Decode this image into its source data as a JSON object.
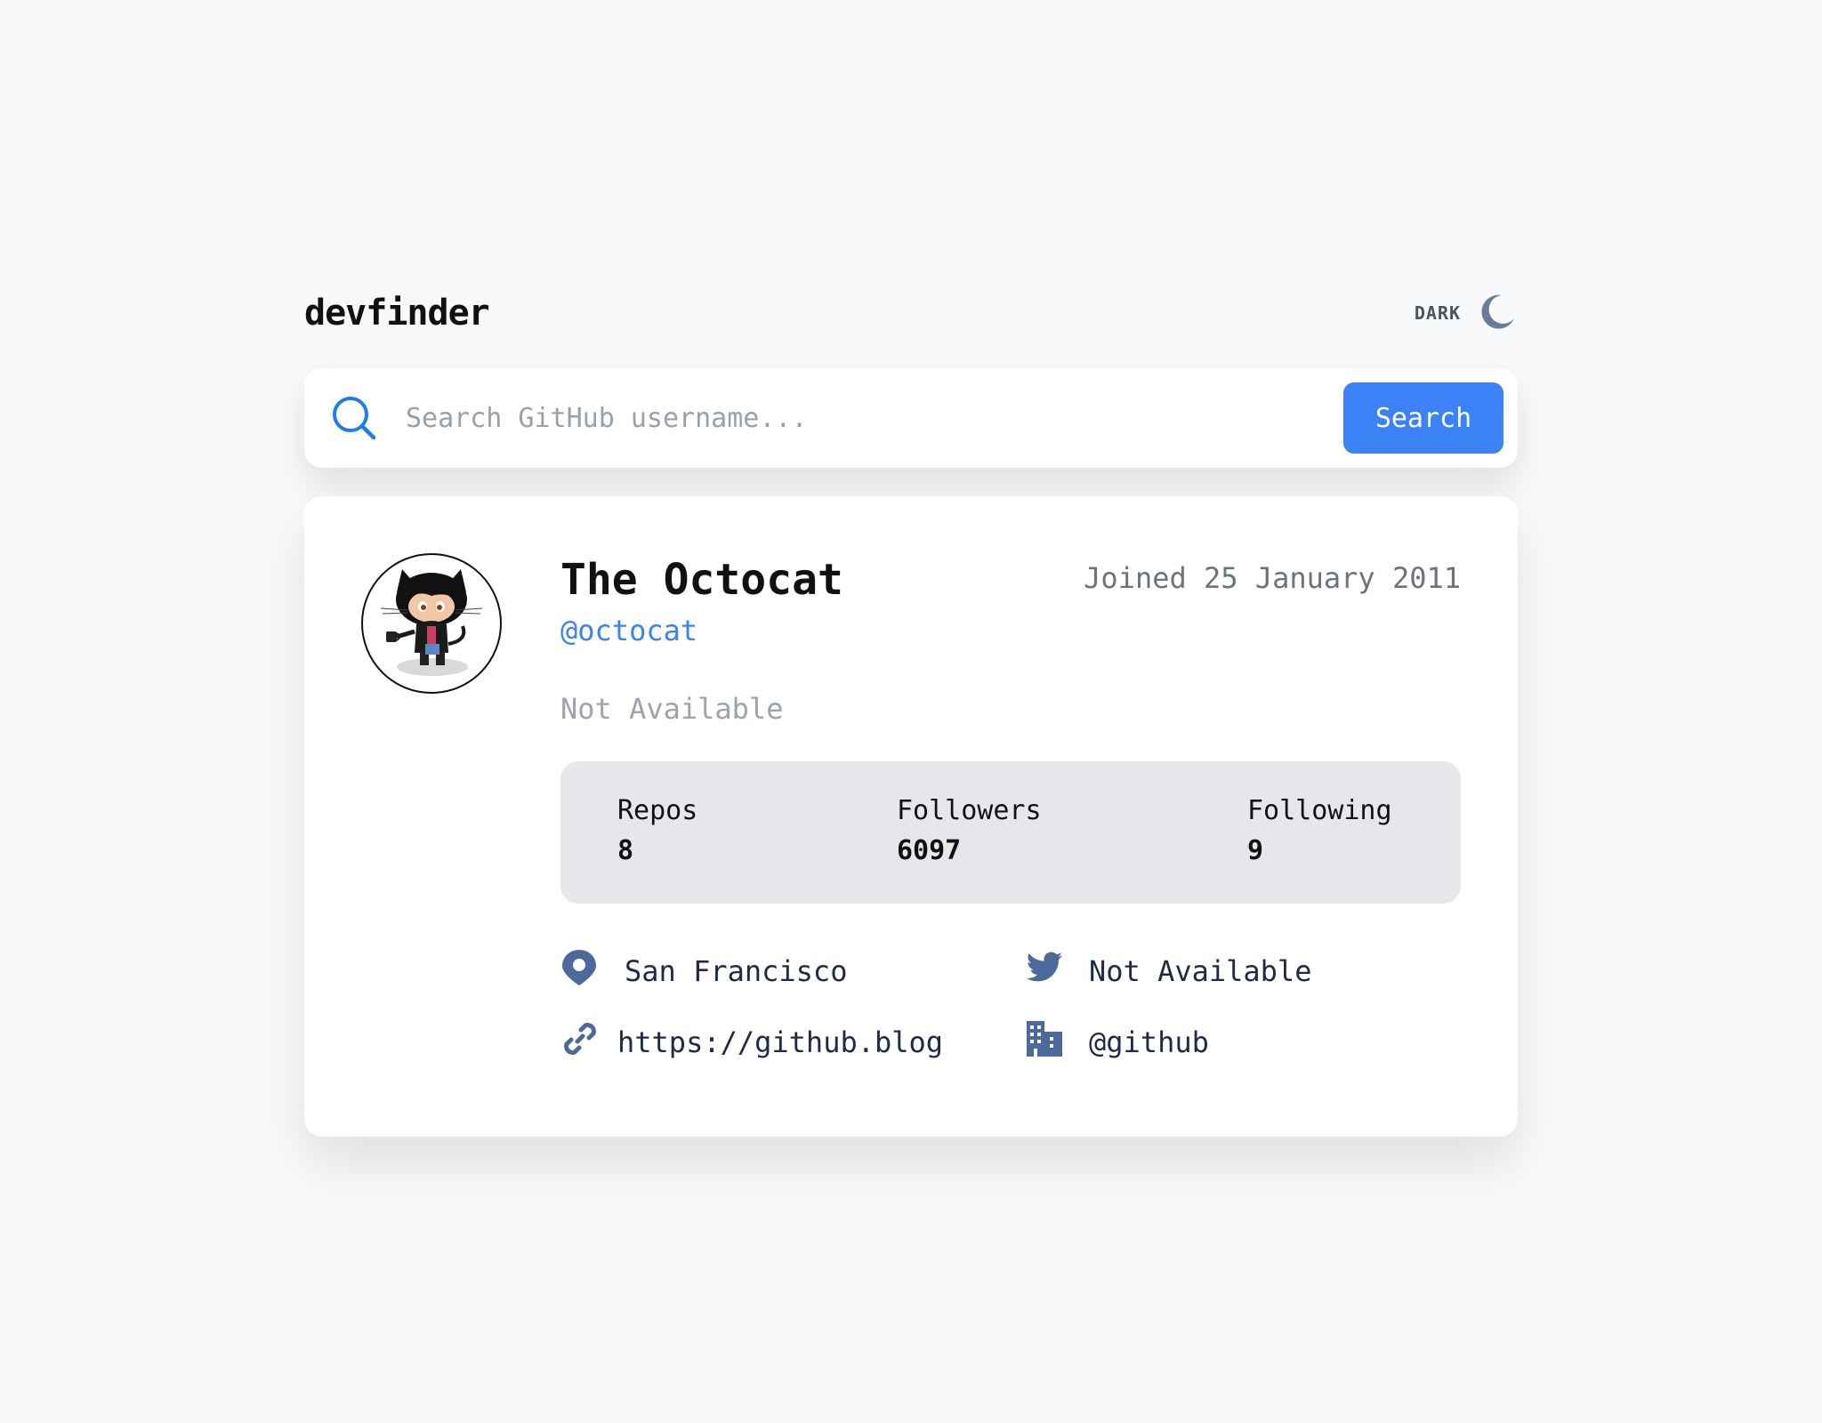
{
  "app": {
    "logo": "devfinder"
  },
  "theme": {
    "label": "DARK",
    "icon": "moon-icon"
  },
  "search": {
    "placeholder": "Search GitHub username...",
    "button_label": "Search",
    "icon": "search-icon"
  },
  "profile": {
    "name": "The Octocat",
    "login": "@octocat",
    "joined": "Joined 25 January 2011",
    "bio": "Not Available",
    "avatar": "octocat-avatar"
  },
  "stats": {
    "repos_label": "Repos",
    "repos_value": "8",
    "followers_label": "Followers",
    "followers_value": "6097",
    "following_label": "Following",
    "following_value": "9"
  },
  "links": {
    "location": "San Francisco",
    "twitter": "Not Available",
    "blog": "https://github.blog",
    "company": "@github"
  },
  "colors": {
    "accent": "#3b82f6",
    "background": "#f8f9fb",
    "card": "#ffffff",
    "stats_bg": "#e5e7eb",
    "icon": "#4b6a9b"
  }
}
